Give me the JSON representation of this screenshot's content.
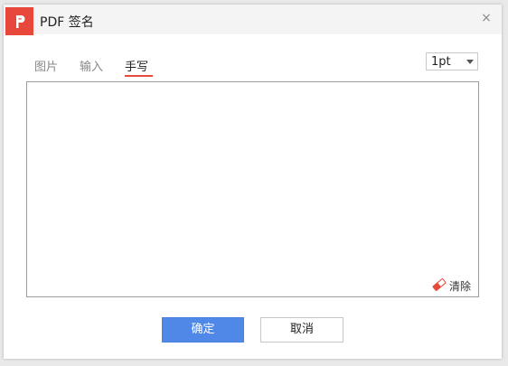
{
  "window": {
    "title": "PDF 签名",
    "close_symbol": "×"
  },
  "tabs": [
    {
      "label": "图片",
      "active": false
    },
    {
      "label": "输入",
      "active": false
    },
    {
      "label": "手写",
      "active": true
    }
  ],
  "pen_width": {
    "selected": "1pt"
  },
  "canvas": {
    "clear_label": "清除",
    "clear_icon": "eraser-icon"
  },
  "footer": {
    "ok_label": "确定",
    "cancel_label": "取消"
  },
  "colors": {
    "logo": "#e8483b",
    "accent_underline": "#e34a3b",
    "primary_button": "#5088e8"
  }
}
